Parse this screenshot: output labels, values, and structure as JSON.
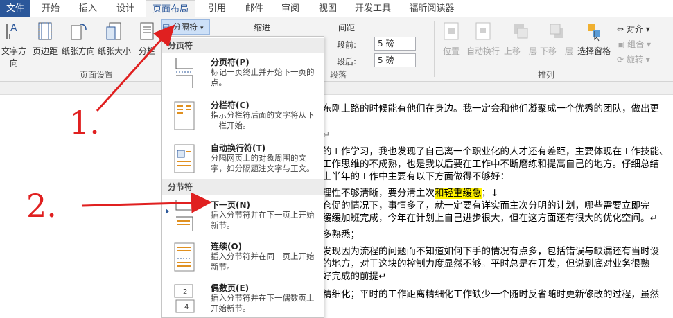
{
  "tabs": [
    "文件",
    "开始",
    "插入",
    "设计",
    "页面布局",
    "引用",
    "邮件",
    "审阅",
    "视图",
    "开发工具",
    "福昕阅读器"
  ],
  "ribbon": {
    "page_setup": {
      "buttons": [
        "文字方向",
        "页边距",
        "纸张方向",
        "纸张大小",
        "分栏"
      ],
      "label": "页面设置"
    },
    "breaks_button": "分隔符",
    "indent_label": "缩进",
    "spacing_label": "间距",
    "before_label": "段前:",
    "after_label": "段后:",
    "before_value": "5 磅",
    "after_value": "5 磅",
    "paragraph_label": "段落",
    "arrange": {
      "buttons": [
        "位置",
        "自动换行",
        "上移一层",
        "下移一层",
        "选择窗格"
      ],
      "small": [
        "对齐",
        "组合",
        "旋转"
      ],
      "label": "排列"
    }
  },
  "menu": {
    "section_page": "分页符",
    "section_section": "分节符",
    "items": [
      {
        "title": "分页符(P)",
        "desc": "标记一页终止并开始下一页的点。"
      },
      {
        "title": "分栏符(C)",
        "desc": "指示分栏符后面的文字将从下一栏开始。"
      },
      {
        "title": "自动换行符(T)",
        "desc": "分隔网页上的对象周围的文字，如分隔题注文字与正文。"
      },
      {
        "title": "下一页(N)",
        "desc": "插入分节符并在下一页上开始新节。"
      },
      {
        "title": "连续(O)",
        "desc": "插入分节符并在同一页上开始新节。"
      },
      {
        "title": "偶数页(E)",
        "desc": "插入分节符并在下一偶数页上开始新节。"
      }
    ]
  },
  "doc_lines": [
    "东刚上路的时候能有他们在身边。我一定会和他们凝聚成一个优秀的团队，做出更",
    "↵",
    "的工作学习，我也发现了自己离一个职业化的人才还有差距，主要体现在工作技能、",
    "工作思维的不成熟，也是我以后要在工作中不断磨练和提高自己的地方。仔细总结",
    "上半年的工作中主要有以下方面做得不够好：",
    "理性不够清晰，要分清主次",
    "和轻重缓急",
    "；↓",
    "仓促的情况下，事情多了，就一定要有详实而主次分明的计划，哪些需要立即完",
    "缓缓加班完成，今年在计划上自己进步很大，但在这方面还有很大的优化空间。↵",
    "多熟悉；",
    "发现因为流程的问题而不知道如何下手的情况有点多，包括错误与缺漏还有当时设",
    "的地方，对于这块的控制力度显然不够。平时总是在开发，但说到底对业务很熟",
    "好完成的前提↵",
    "精细化；平时的工作距离精细化工作缺少一个随时反省随时更新修改的过程，虽然"
  ],
  "annotations": [
    "1.",
    "2."
  ],
  "colors": {
    "accent": "#2b579a",
    "annotation": "#e02020",
    "highlight": "#fff200"
  }
}
